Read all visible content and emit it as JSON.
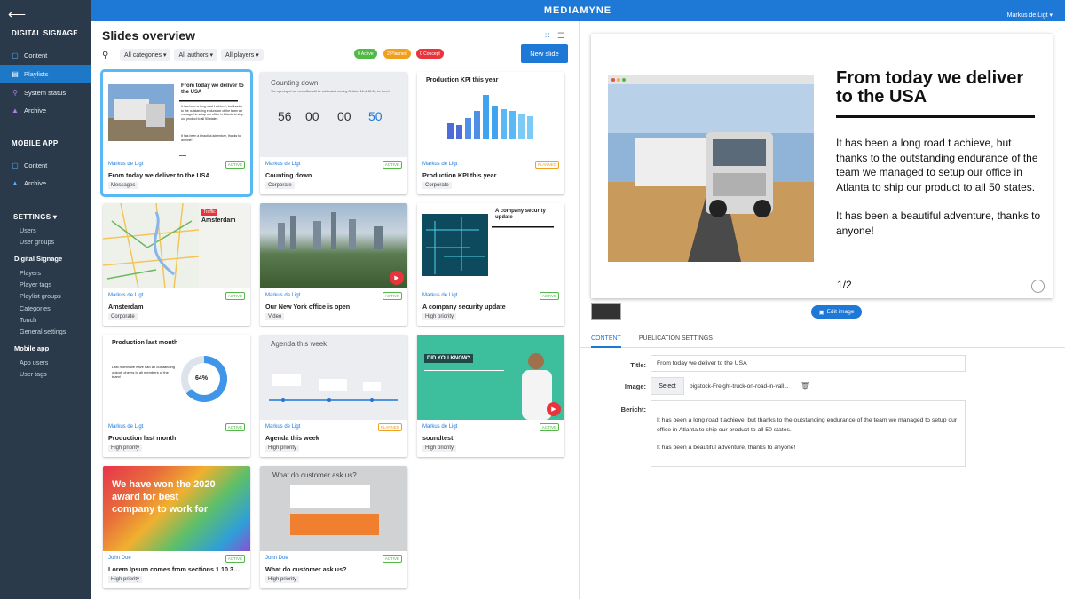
{
  "brand": "MEDIAMYNE",
  "user": "Markus de Ligt ▾",
  "sidebar": {
    "digital_signage": "DIGITAL SIGNAGE",
    "content": "Content",
    "playlists": "Playlists",
    "system_status": "System status",
    "archive": "Archive",
    "mobile_app": "MOBILE APP",
    "mobile_content": "Content",
    "mobile_archive": "Archive",
    "settings": "SETTINGS ▾",
    "users": "Users",
    "user_groups": "User groups",
    "ds_heading": "Digital Signage",
    "players": "Players",
    "player_tags": "Player tags",
    "playlist_groups": "Playlist groups",
    "categories": "Categories",
    "touch": "Touch",
    "general_settings": "General settings",
    "mobile_heading": "Mobile app",
    "app_users": "App users",
    "user_tags": "User tags"
  },
  "overview": {
    "title": "Slides overview",
    "filter_categories": "All categories ▾",
    "filter_authors": "All authors ▾",
    "filter_players": "All players ▾",
    "pill_active": "0 Active",
    "pill_planned": "2 Planned",
    "pill_concept": "0 Concept",
    "new_slide": "New slide"
  },
  "cards": [
    {
      "author": "Markus de Ligt",
      "status": "ACTIVE",
      "title": "From today we deliver to the USA",
      "tag": "Messages",
      "thumb_title": "From today we deliver to the USA"
    },
    {
      "author": "Markus de Ligt",
      "status": "ACTIVE",
      "title": "Counting down",
      "tag": "Corporate",
      "thumb_title": "Counting down",
      "thumb_text": "The opening of our new office will be celebrated coming October 16 at 12:00, be there!",
      "d": "56",
      "h": "00",
      "m": "00",
      "s": "50"
    },
    {
      "author": "Markus de Ligt",
      "status": "PLANNED",
      "title": "Production KPI this year",
      "tag": "Corporate",
      "thumb_title": "Production KPI this year"
    },
    {
      "author": "Markus de Ligt",
      "status": "ACTIVE",
      "title": "Amsterdam",
      "tag": "Corporate",
      "thumb_title": "Amsterdam",
      "thumb_badge": "Traffic"
    },
    {
      "author": "Markus de Ligt",
      "status": "ACTIVE",
      "title": "Our New York office is open",
      "tag": "Video"
    },
    {
      "author": "Markus de Ligt",
      "status": "ACTIVE",
      "title": "A company security update",
      "tag": "High priority",
      "thumb_title": "A company security update"
    },
    {
      "author": "Markus de Ligt",
      "status": "ACTIVE",
      "title": "Production last month",
      "tag": "High priority",
      "thumb_title": "Production last month",
      "thumb_text": "Last month we have had an outstanding output, cheers to all members of the team!",
      "pct": "64%"
    },
    {
      "author": "Markus de Ligt",
      "status": "PLANNED",
      "title": "Agenda this week",
      "tag": "High priority",
      "thumb_title": "Agenda this week"
    },
    {
      "author": "Markus de Ligt",
      "status": "ACTIVE",
      "title": "soundtest",
      "tag": "High priority",
      "thumb_title": "DID YOU KNOW?"
    },
    {
      "author": "John Doe",
      "status": "ACTIVE",
      "title": "Lorem Ipsum comes from sections 1.10.3…",
      "tag": "High priority",
      "thumb_title": "We have won the 2020 award for best company to work for"
    },
    {
      "author": "John Doe",
      "status": "ACTIVE",
      "title": "What do customer ask us?",
      "tag": "High priority",
      "thumb_title": "What do customer ask us?"
    }
  ],
  "preview": {
    "title": "From today we deliver to the USA",
    "body1": "It has been a long road t achieve, but thanks to the outstanding endurance of the team we managed to setup our office in Atlanta to ship our product to all 50 states.",
    "body2": "It has been a beautiful adventure, thanks to anyone!",
    "page": "1/2",
    "edit_image": "Edit image"
  },
  "editor": {
    "tab_content": "CONTENT",
    "tab_publication": "PUBLICATION SETTINGS",
    "title_label": "Title:",
    "title_value": "From today we deliver to the USA",
    "image_label": "Image:",
    "select_label": "Select",
    "image_file": "bigstock-Freight-truck-on-road-in-vall...",
    "bericht_label": "Bericht:",
    "bericht_p1": "It has been a long road t achieve, but thanks to the outstanding endurance of the team we managed to setup our office in Atlanta to ship our product to all 50 states.",
    "bericht_p2": "It has been a beautiful adventure, thanks to anyone!"
  },
  "colors": {
    "primary": "#1e78d6",
    "sidebar": "#2b3a4a",
    "active": "#52b848",
    "planned": "#f0a020",
    "concept": "#e8343c"
  }
}
